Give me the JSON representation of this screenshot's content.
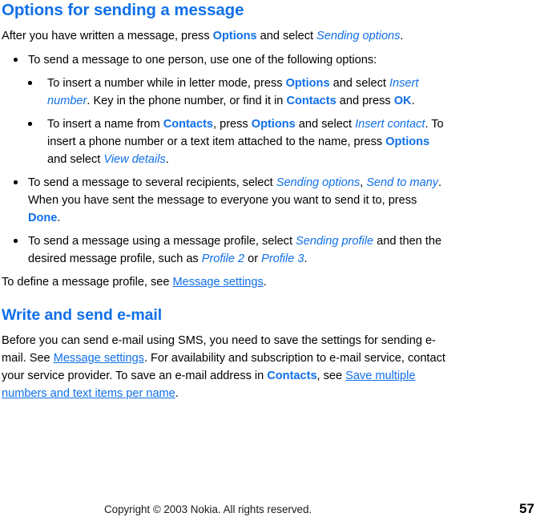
{
  "document": {
    "accent_color": "#1070e8",
    "text_color": "#000000",
    "page_background": "#ffffff"
  },
  "section": {
    "title": "Options for sending a message",
    "intro": {
      "t1": "After you have written a message, press ",
      "k1": "Options",
      "t2": " and select ",
      "m1": "Sending options",
      "t3": "."
    },
    "bullets": [
      {
        "id": "send-one-person",
        "text": "To send a message to one person, use one of the following options:",
        "children": [
          {
            "id": "insert-number",
            "t1": "To insert a number while in letter mode, press ",
            "k1": "Options",
            "t2": " and select ",
            "m1": "Insert number",
            "t3": ". Key in the phone number, or find it in ",
            "k2": "Contacts",
            "t4": " and press ",
            "k3": "OK",
            "t5": "."
          },
          {
            "id": "insert-contact",
            "t1": "To insert a name from ",
            "k1": "Contacts",
            "t2": ", press ",
            "k2": "Options",
            "t3": " and select ",
            "m1": "Insert contact",
            "t4": ". To insert a phone number or a text item attached to the name, press ",
            "k3": "Options",
            "t5": " and select ",
            "m2": "View details",
            "t6": "."
          }
        ]
      },
      {
        "id": "send-many",
        "t1": "To send a message to several recipients, select ",
        "m1": "Sending options",
        "t2": ", ",
        "m2": "Send to many",
        "t3": ". When you have sent the message to everyone you want to send it to, press ",
        "k1": "Done",
        "t4": "."
      },
      {
        "id": "send-with-profile",
        "t1": "To send a message using a message profile, select ",
        "m1": "Sending profile",
        "t2": " and then the desired message profile, such as ",
        "m2": "Profile 2",
        "t3": " or ",
        "m3": "Profile 3",
        "t4": "."
      }
    ],
    "closing": {
      "t1": "To define a message profile, see ",
      "link1": "Message settings",
      "t2": "."
    }
  },
  "subsection": {
    "title": "Write and send e-mail",
    "paragraph": {
      "t1": "Before you can send e-mail using SMS, you need to save the settings for sending e-mail. See ",
      "link1": "Message settings",
      "t2": ". For availability and subscription to e-mail service, contact your service provider. To save an e-mail address in ",
      "k1": "Contacts",
      "t3": ", see ",
      "link2": "Save multiple numbers and text items per name",
      "t4": "."
    }
  },
  "footer": {
    "copyright": "Copyright © 2003 Nokia. All rights reserved.",
    "page_number": "57"
  }
}
